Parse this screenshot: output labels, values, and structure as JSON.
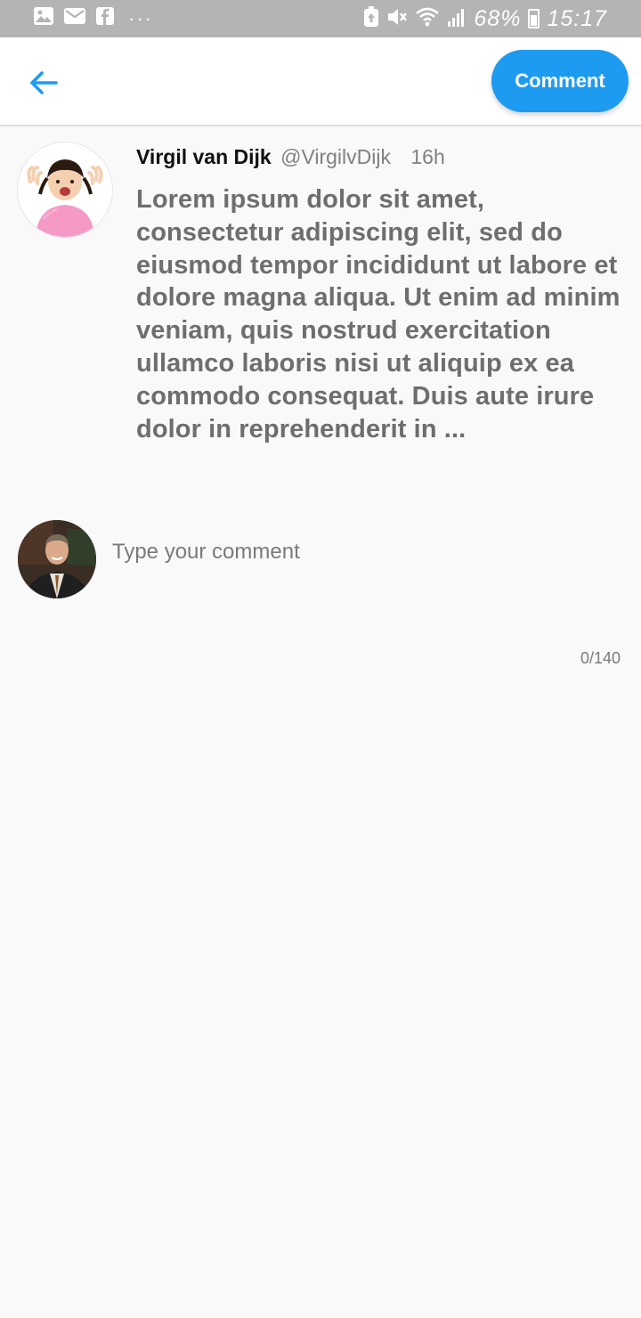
{
  "status_bar": {
    "battery": "68%",
    "time": "15:17",
    "dots": "···",
    "icons": [
      "gallery-icon",
      "mail-icon",
      "facebook-icon",
      "more-icon",
      "battery-saver-icon",
      "mute-icon",
      "wifi-icon",
      "signal-icon",
      "battery-icon"
    ]
  },
  "app_bar": {
    "back_icon": "arrow-left-icon",
    "comment_label": "Comment"
  },
  "tweet": {
    "author_name": "Virgil van Dijk",
    "author_handle": "@VirgilvDijk",
    "time": "16h",
    "text": "Lorem ipsum dolor sit amet, consectetur adipiscing elit, sed do eiusmod tempor incididunt ut labore et dolore magna aliqua. Ut enim ad minim veniam, quis nostrud exercitation ullamco laboris nisi ut aliquip ex ea commodo consequat. Duis aute irure dolor in reprehenderit in ..."
  },
  "compose": {
    "placeholder": "Type your comment",
    "value": "",
    "counter": "0/140"
  },
  "colors": {
    "accent": "#1d9bf0",
    "status_bar": "#b4b4b4",
    "background": "#f9f9f9"
  }
}
